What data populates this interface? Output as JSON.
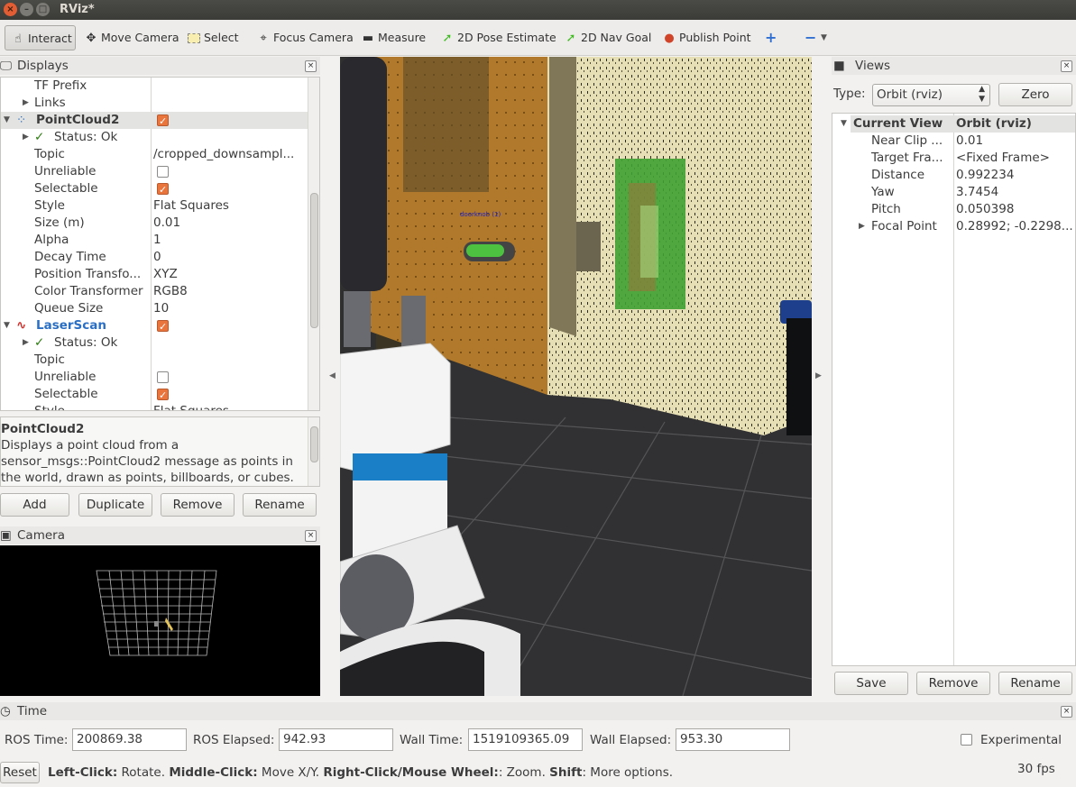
{
  "window": {
    "title": "RViz*"
  },
  "toolbar": {
    "interact": "Interact",
    "move_camera": "Move Camera",
    "select": "Select",
    "focus_camera": "Focus Camera",
    "measure": "Measure",
    "pose_estimate": "2D Pose Estimate",
    "nav_goal": "2D Nav Goal",
    "publish_point": "Publish Point",
    "plus": "+",
    "minus": "−"
  },
  "displays": {
    "title": "Displays",
    "rows": [
      {
        "k": "TF Prefix",
        "v": ""
      },
      {
        "k": "Links",
        "v": ""
      },
      {
        "k": "PointCloud2",
        "v": ""
      },
      {
        "k": "Status: Ok",
        "v": ""
      },
      {
        "k": "Topic",
        "v": "/cropped_downsampl..."
      },
      {
        "k": "Unreliable",
        "v": ""
      },
      {
        "k": "Selectable",
        "v": ""
      },
      {
        "k": "Style",
        "v": "Flat Squares"
      },
      {
        "k": "Size (m)",
        "v": "0.01"
      },
      {
        "k": "Alpha",
        "v": "1"
      },
      {
        "k": "Decay Time",
        "v": "0"
      },
      {
        "k": "Position Transfo...",
        "v": "XYZ"
      },
      {
        "k": "Color Transformer",
        "v": "RGB8"
      },
      {
        "k": "Queue Size",
        "v": "10"
      },
      {
        "k": "LaserScan",
        "v": ""
      },
      {
        "k": "Status: Ok",
        "v": ""
      },
      {
        "k": "Topic",
        "v": ""
      },
      {
        "k": "Unreliable",
        "v": ""
      },
      {
        "k": "Selectable",
        "v": ""
      },
      {
        "k": "Style",
        "v": "Flat Squares"
      }
    ],
    "desc_title": "PointCloud2",
    "desc_line1": "Displays a point cloud from a",
    "desc_line2": "sensor_msgs::PointCloud2 message as points in",
    "desc_line3": "the world, drawn as points, billboards, or cubes.",
    "add": "Add",
    "duplicate": "Duplicate",
    "remove": "Remove",
    "rename": "Rename"
  },
  "camera_panel": {
    "title": "Camera"
  },
  "viewport": {
    "marker_label": "doorknob  (1)"
  },
  "views": {
    "title": "Views",
    "type_label": "Type:",
    "type_value": "Orbit (rviz)",
    "zero": "Zero",
    "header_k": "Current View",
    "header_v": "Orbit (rviz)",
    "rows": [
      {
        "k": "Near Clip ...",
        "v": "0.01"
      },
      {
        "k": "Target Fra...",
        "v": "<Fixed Frame>"
      },
      {
        "k": "Distance",
        "v": "0.992234"
      },
      {
        "k": "Yaw",
        "v": "3.7454"
      },
      {
        "k": "Pitch",
        "v": "0.050398"
      },
      {
        "k": "Focal Point",
        "v": "0.28992; -0.2298..."
      }
    ],
    "save": "Save",
    "remove": "Remove",
    "rename": "Rename"
  },
  "time": {
    "title": "Time",
    "ros_time_label": "ROS Time:",
    "ros_time": "200869.38",
    "ros_elapsed_label": "ROS Elapsed:",
    "ros_elapsed": "942.93",
    "wall_time_label": "Wall Time:",
    "wall_time": "1519109365.09",
    "wall_elapsed_label": "Wall Elapsed:",
    "wall_elapsed": "953.30",
    "experimental": "Experimental"
  },
  "status": {
    "reset": "Reset",
    "left": "Left-Click:",
    "left_t": " Rotate. ",
    "middle": "Middle-Click:",
    "middle_t": " Move X/Y. ",
    "right": "Right-Click/Mouse Wheel:",
    "right_t": ": Zoom. ",
    "shift": "Shift",
    "shift_t": ": More options.",
    "fps": "30 fps"
  },
  "colors": {
    "accent": "#e9743c",
    "selection": "#e3e3e1",
    "blue_label": "#2a6fc4"
  }
}
